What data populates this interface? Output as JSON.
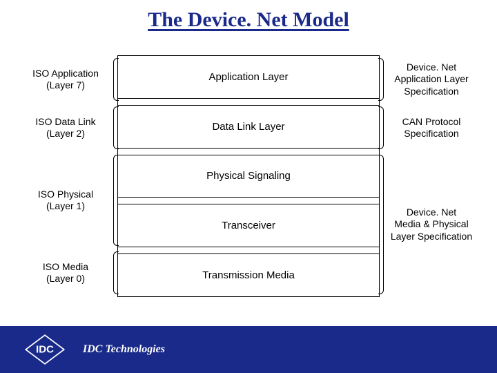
{
  "title": "The Device. Net Model",
  "left_iso": [
    {
      "line1": "ISO Application",
      "line2": "(Layer 7)"
    },
    {
      "line1": "ISO Data Link",
      "line2": "(Layer 2)"
    },
    {
      "line1": "ISO Physical",
      "line2": "(Layer 1)"
    },
    {
      "line1": "ISO Media",
      "line2": "(Layer 0)"
    }
  ],
  "center_layers": [
    "Application Layer",
    "Data Link Layer",
    "Physical Signaling",
    "Transceiver",
    "Transmission Media"
  ],
  "right_specs": [
    {
      "line1": "Device. Net",
      "line2": "Application Layer",
      "line3": "Specification"
    },
    {
      "line1": "CAN Protocol",
      "line2": "Specification",
      "line3": ""
    },
    {
      "line1": "Device. Net",
      "line2": "Media & Physical",
      "line3": "Layer Specification"
    }
  ],
  "footer": {
    "company": "IDC Technologies",
    "logo_text": "IDC"
  },
  "colors": {
    "brand_blue": "#1a2a8a"
  }
}
